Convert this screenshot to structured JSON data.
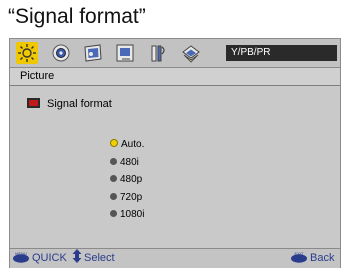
{
  "caption": "“Signal format”",
  "toolbar": {
    "icons": [
      "picture-icon",
      "sound-icon",
      "screen-icon",
      "timer-icon",
      "setup-icon",
      "tools-icon"
    ],
    "active_index": 0,
    "source_label": "Y/PB/PR"
  },
  "breadcrumb": "Picture",
  "panel": {
    "title": "Signal format",
    "options": [
      {
        "label": "Auto.",
        "selected": true
      },
      {
        "label": "480i",
        "selected": false
      },
      {
        "label": "480p",
        "selected": false
      },
      {
        "label": "720p",
        "selected": false
      },
      {
        "label": "1080i",
        "selected": false
      }
    ]
  },
  "footer": {
    "menu_tag": "MENU",
    "quick_label": "QUICK",
    "select_label": "Select",
    "exit_tag": "EXIT",
    "back_label": "Back"
  },
  "colors": {
    "highlight": "#f0c800",
    "footer_text": "#2a3c8c"
  }
}
